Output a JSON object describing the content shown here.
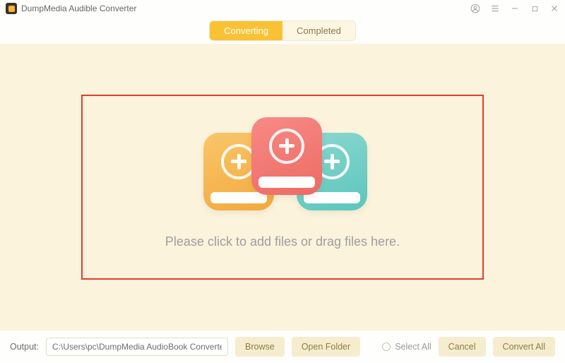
{
  "titlebar": {
    "title": "DumpMedia Audible Converter"
  },
  "tabs": {
    "converting": "Converting",
    "completed": "Completed"
  },
  "dropzone": {
    "hint": "Please click to add files or drag files here."
  },
  "footer": {
    "output_label": "Output:",
    "output_path": "C:\\Users\\pc\\DumpMedia AudioBook Converte",
    "browse": "Browse",
    "open_folder": "Open Folder",
    "select_all": "Select All",
    "cancel": "Cancel",
    "convert_all": "Convert All"
  }
}
